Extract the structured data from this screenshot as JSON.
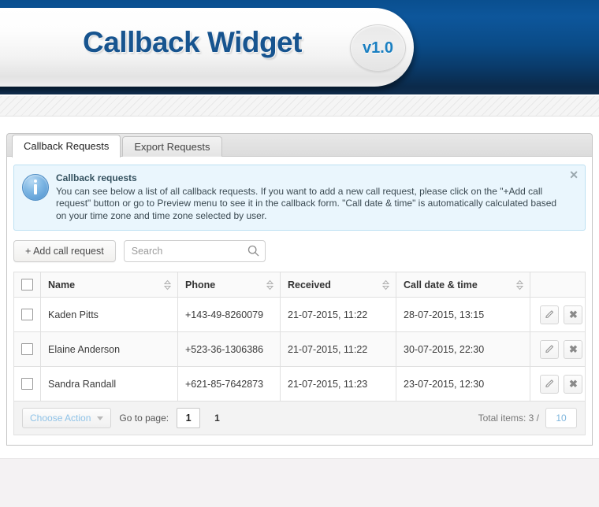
{
  "header": {
    "title": "Callback Widget",
    "version": "v1.0",
    "accent_color": "#17548f",
    "version_color": "#1a7fc1"
  },
  "tabs": [
    {
      "label": "Callback Requests",
      "active": true
    },
    {
      "label": "Export Requests",
      "active": false
    }
  ],
  "notice": {
    "icon": "info-icon",
    "title": "Callback requests",
    "body": "You can see below a list of all callback requests. If you want to add a new call request, please click on the \"+Add call request\" button or go to Preview menu to see it in the callback form. \"Call date & time\" is automatically calculated based on your time zone and time zone selected by user.",
    "close_label": "✕",
    "background_color": "#eaf6fd",
    "border_color": "#bde0f2"
  },
  "toolbar": {
    "add_label": "+ Add call request",
    "search_placeholder": "Search",
    "search_value": "",
    "search_icon": "search-icon"
  },
  "table": {
    "columns": [
      {
        "label": "",
        "sortable": false,
        "type": "checkbox"
      },
      {
        "label": "Name",
        "sortable": true
      },
      {
        "label": "Phone",
        "sortable": true
      },
      {
        "label": "Received",
        "sortable": true
      },
      {
        "label": "Call date & time",
        "sortable": true
      },
      {
        "label": "",
        "sortable": false,
        "type": "actions"
      }
    ],
    "rows": [
      {
        "name": "Kaden Pitts",
        "phone": "+143-49-8260079",
        "received": "21-07-2015, 11:22",
        "call_datetime": "28-07-2015, 13:15",
        "edit_label": "edit",
        "delete_label": "✖"
      },
      {
        "name": "Elaine Anderson",
        "phone": "+523-36-1306386",
        "received": "21-07-2015, 11:22",
        "call_datetime": "30-07-2015, 22:30",
        "edit_label": "edit",
        "delete_label": "✖"
      },
      {
        "name": "Sandra Randall",
        "phone": "+621-85-7642873",
        "received": "21-07-2015, 11:23",
        "call_datetime": "23-07-2015, 12:30",
        "edit_label": "edit",
        "delete_label": "✖"
      }
    ]
  },
  "footer": {
    "choose_action_label": "Choose Action",
    "goto_label": "Go to page:",
    "page_value": "1",
    "current_page": "1",
    "total_label": "Total items: 3 /",
    "per_page": "10"
  }
}
